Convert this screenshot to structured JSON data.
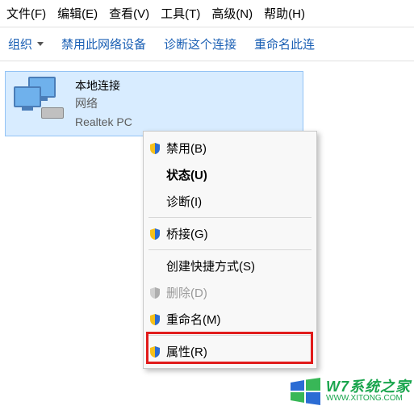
{
  "menubar": {
    "file": "文件(F)",
    "edit": "编辑(E)",
    "view": "查看(V)",
    "tools": "工具(T)",
    "advanced": "高级(N)",
    "help": "帮助(H)"
  },
  "toolbar": {
    "organize": "组织",
    "disable": "禁用此网络设备",
    "diagnose": "诊断这个连接",
    "rename": "重命名此连"
  },
  "adapter": {
    "title": "本地连接",
    "network": "网络",
    "device": "Realtek PC"
  },
  "context_menu": {
    "disable": "禁用(B)",
    "status": "状态(U)",
    "diagnose": "诊断(I)",
    "bridge": "桥接(G)",
    "shortcut": "创建快捷方式(S)",
    "delete": "删除(D)",
    "rename": "重命名(M)",
    "properties": "属性(R)"
  },
  "watermark": {
    "title": "W7系统之家",
    "url": "WWW.XITONG.COM"
  }
}
